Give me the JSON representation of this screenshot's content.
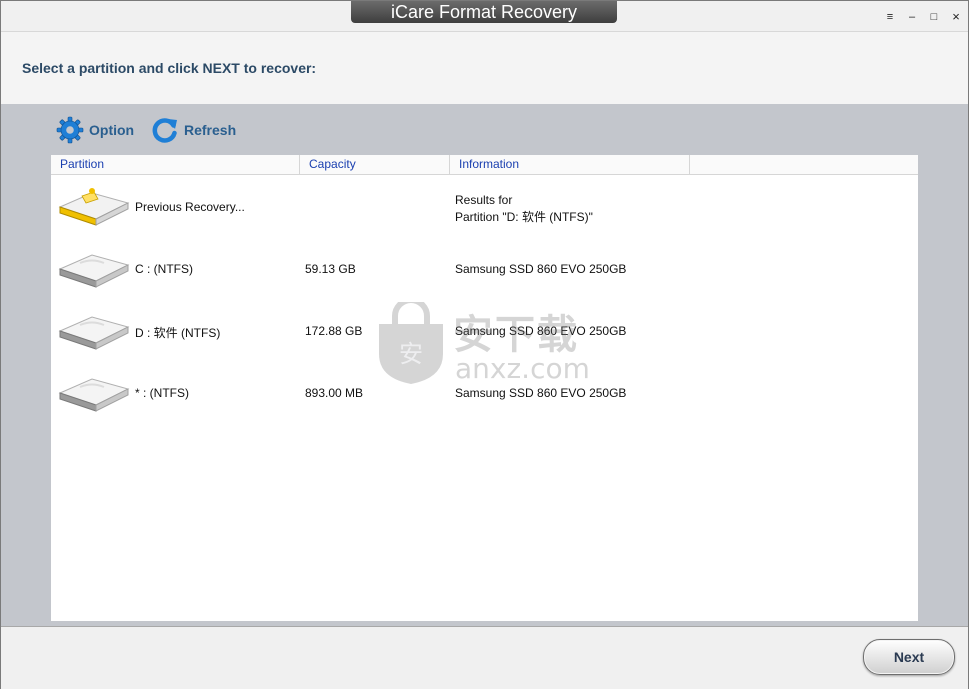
{
  "window": {
    "title": "iCare Format Recovery",
    "controls": {
      "menu": "≡",
      "minimize": "–",
      "maximize": "□",
      "close": "×"
    }
  },
  "header": {
    "instruction": "Select a partition and click NEXT to recover:"
  },
  "toolbar": {
    "option_label": "Option",
    "refresh_label": "Refresh"
  },
  "list": {
    "columns": [
      "Partition",
      "Capacity",
      "Information"
    ],
    "rows": [
      {
        "partition": "Previous Recovery...",
        "capacity": "",
        "info_line1": "Results for",
        "info_line2": "Partition \"D: 软件 (NTFS)\"",
        "icon": "yellow-recovery-drive-icon"
      },
      {
        "partition": "C :   (NTFS)",
        "capacity": "59.13 GB",
        "info_line1": "Samsung SSD 860 EVO 250GB",
        "info_line2": "",
        "icon": "hard-drive-icon"
      },
      {
        "partition": "D : 软件  (NTFS)",
        "capacity": "172.88 GB",
        "info_line1": "Samsung SSD 860 EVO 250GB",
        "info_line2": "",
        "icon": "hard-drive-icon"
      },
      {
        "partition": "* :   (NTFS)",
        "capacity": "893.00 MB",
        "info_line1": "Samsung SSD 860 EVO 250GB",
        "info_line2": "",
        "icon": "hard-drive-icon"
      }
    ]
  },
  "watermark": {
    "text_cn": "安下载",
    "text_en": "anxz.com",
    "shield_char": "安"
  },
  "footer": {
    "next_label": "Next"
  },
  "colors": {
    "accent": "#2a5f8f",
    "main_bg": "#c3c6cc",
    "column_header_text": "#1a3fb0"
  }
}
